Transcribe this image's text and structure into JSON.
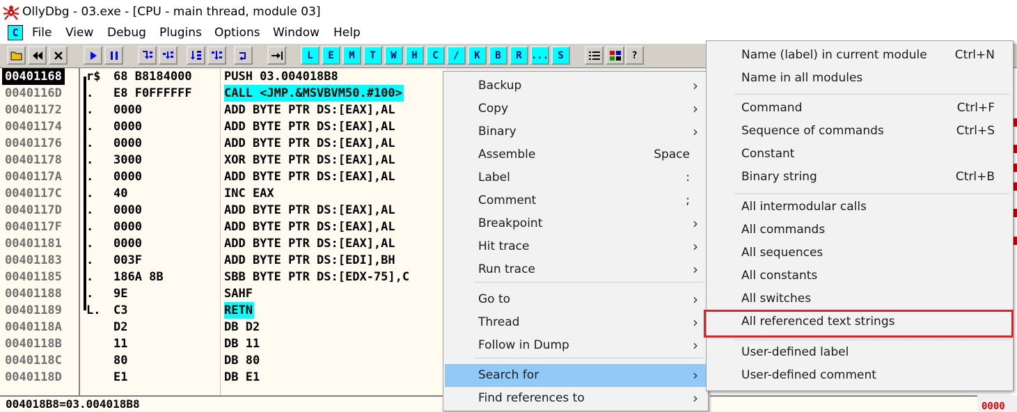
{
  "window": {
    "title": "OllyDbg - 03.exe - [CPU - main thread, module 03]"
  },
  "menubar": {
    "items": [
      "File",
      "View",
      "Debug",
      "Plugins",
      "Options",
      "Window",
      "Help"
    ]
  },
  "toolbar": {
    "icons": [
      "open-icon",
      "restart-icon",
      "close-icon",
      "run-icon",
      "pause-icon",
      "step-into-icon",
      "step-over-icon",
      "trace-into-icon",
      "trace-over-icon",
      "execute-till-return-icon",
      "go-to-icon"
    ],
    "letters": [
      "L",
      "E",
      "M",
      "T",
      "W",
      "H",
      "C",
      "/",
      "K",
      "B",
      "R",
      "...",
      "S"
    ],
    "extra_icons": [
      "list-icon",
      "grid-icon",
      "help-icon"
    ]
  },
  "disassembly": {
    "rows": [
      {
        "addr": "00401168",
        "mark": "r$",
        "hex": "68 B8184000",
        "asm": "PUSH 03.004018B8",
        "selected": true
      },
      {
        "addr": "0040116D",
        "mark": ".",
        "hex": "E8 F0FFFFFF",
        "asm": "CALL <JMP.&MSVBVM50.#100>",
        "highlight": true
      },
      {
        "addr": "00401172",
        "mark": ".",
        "hex": "0000",
        "asm": "ADD BYTE PTR DS:[EAX],AL"
      },
      {
        "addr": "00401174",
        "mark": ".",
        "hex": "0000",
        "asm": "ADD BYTE PTR DS:[EAX],AL"
      },
      {
        "addr": "00401176",
        "mark": ".",
        "hex": "0000",
        "asm": "ADD BYTE PTR DS:[EAX],AL"
      },
      {
        "addr": "00401178",
        "mark": ".",
        "hex": "3000",
        "asm": "XOR BYTE PTR DS:[EAX],AL"
      },
      {
        "addr": "0040117A",
        "mark": ".",
        "hex": "0000",
        "asm": "ADD BYTE PTR DS:[EAX],AL"
      },
      {
        "addr": "0040117C",
        "mark": ".",
        "hex": "40",
        "asm": "INC EAX"
      },
      {
        "addr": "0040117D",
        "mark": ".",
        "hex": "0000",
        "asm": "ADD BYTE PTR DS:[EAX],AL"
      },
      {
        "addr": "0040117F",
        "mark": ".",
        "hex": "0000",
        "asm": "ADD BYTE PTR DS:[EAX],AL"
      },
      {
        "addr": "00401181",
        "mark": ".",
        "hex": "0000",
        "asm": "ADD BYTE PTR DS:[EAX],AL"
      },
      {
        "addr": "00401183",
        "mark": ".",
        "hex": "003F",
        "asm": "ADD BYTE PTR DS:[EDI],BH"
      },
      {
        "addr": "00401185",
        "mark": ".",
        "hex": "186A 8B",
        "asm": "SBB BYTE PTR DS:[EDX-75],C"
      },
      {
        "addr": "00401188",
        "mark": ".",
        "hex": "9E",
        "asm": "SAHF"
      },
      {
        "addr": "00401189",
        "mark": "L.",
        "hex": "C3",
        "asm": "RETN",
        "highlight": true
      },
      {
        "addr": "0040118A",
        "mark": "",
        "hex": "D2",
        "asm": "DB D2"
      },
      {
        "addr": "0040118B",
        "mark": "",
        "hex": "11",
        "asm": "DB 11"
      },
      {
        "addr": "0040118C",
        "mark": "",
        "hex": "80",
        "asm": "DB 80"
      },
      {
        "addr": "0040118D",
        "mark": "",
        "hex": "E1",
        "asm": "DB E1"
      }
    ],
    "info_line": "004018B8=03.004018B8"
  },
  "context_menu": {
    "items": [
      {
        "label": "Backup",
        "shortcut": "",
        "submenu": true
      },
      {
        "label": "Copy",
        "shortcut": "",
        "submenu": true
      },
      {
        "label": "Binary",
        "shortcut": "",
        "submenu": true
      },
      {
        "label": "Assemble",
        "shortcut": "Space",
        "submenu": false
      },
      {
        "label": "Label",
        "shortcut": ":",
        "submenu": false
      },
      {
        "label": "Comment",
        "shortcut": ";",
        "submenu": false
      },
      {
        "label": "Breakpoint",
        "shortcut": "",
        "submenu": true
      },
      {
        "label": "Hit trace",
        "shortcut": "",
        "submenu": true
      },
      {
        "label": "Run trace",
        "shortcut": "",
        "submenu": true
      },
      {
        "label": "Go to",
        "shortcut": "",
        "submenu": true
      },
      {
        "label": "Thread",
        "shortcut": "",
        "submenu": true
      },
      {
        "label": "Follow in Dump",
        "shortcut": "",
        "submenu": true
      },
      {
        "label": "Search for",
        "shortcut": "",
        "submenu": true,
        "active": true
      },
      {
        "label": "Find references to",
        "shortcut": "",
        "submenu": true
      }
    ]
  },
  "submenu": {
    "items": [
      {
        "label": "Name (label) in current module",
        "shortcut": "Ctrl+N"
      },
      {
        "label": "Name in all modules",
        "shortcut": ""
      },
      {
        "label": "Command",
        "shortcut": "Ctrl+F"
      },
      {
        "label": "Sequence of commands",
        "shortcut": "Ctrl+S"
      },
      {
        "label": "Constant",
        "shortcut": ""
      },
      {
        "label": "Binary string",
        "shortcut": "Ctrl+B"
      },
      {
        "label": "All intermodular calls",
        "shortcut": ""
      },
      {
        "label": "All commands",
        "shortcut": ""
      },
      {
        "label": "All sequences",
        "shortcut": ""
      },
      {
        "label": "All constants",
        "shortcut": ""
      },
      {
        "label": "All switches",
        "shortcut": ""
      },
      {
        "label": "All referenced text strings",
        "shortcut": "",
        "annotated": true
      },
      {
        "label": "User-defined label",
        "shortcut": ""
      },
      {
        "label": "User-defined comment",
        "shortcut": ""
      }
    ]
  },
  "right_bottom_hex": "0000",
  "colors": {
    "highlight_cyan": "#00ffff",
    "menu_hover": "#91c9f7",
    "annotation_red": "#e0202a"
  }
}
